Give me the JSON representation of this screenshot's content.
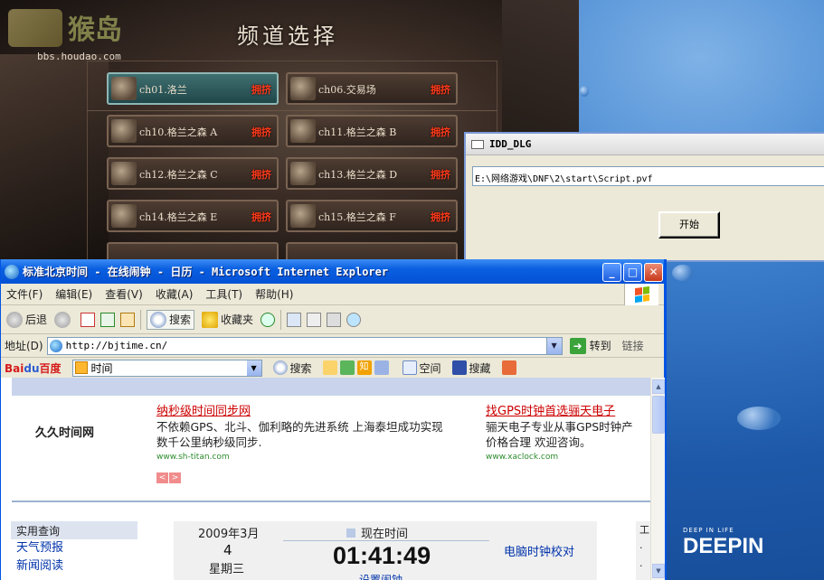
{
  "game": {
    "logo_text": "猴岛",
    "logo_url": "bbs.houdao.com",
    "title": "频道选择",
    "channels": [
      {
        "label": "ch01.洛兰",
        "status": "拥挤",
        "selected": true
      },
      {
        "label": "ch06.交易场",
        "status": "拥挤",
        "selected": false
      },
      {
        "label": "ch10.格兰之森 A",
        "status": "拥挤",
        "selected": false
      },
      {
        "label": "ch11.格兰之森 B",
        "status": "拥挤",
        "selected": false
      },
      {
        "label": "ch12.格兰之森 C",
        "status": "拥挤",
        "selected": false
      },
      {
        "label": "ch13.格兰之森 D",
        "status": "拥挤",
        "selected": false
      },
      {
        "label": "ch14.格兰之森 E",
        "status": "拥挤",
        "selected": false
      },
      {
        "label": "ch15.格兰之森 F",
        "status": "拥挤",
        "selected": false
      }
    ]
  },
  "idd_dialog": {
    "title": "IDD_DLG",
    "path_value": "E:\\网络游戏\\DNF\\2\\start\\Script.pvf",
    "start_button": "开始"
  },
  "ie": {
    "title": "标准北京时间 - 在线闹钟 - 日历 - Microsoft Internet Explorer",
    "caption_buttons": {
      "minimize": "_",
      "maximize": "□",
      "close": "✕"
    },
    "menu": [
      "文件(F)",
      "编辑(E)",
      "查看(V)",
      "收藏(A)",
      "工具(T)",
      "帮助(H)"
    ],
    "toolbar": {
      "back": "后退",
      "search": "搜索",
      "favorites": "收藏夹"
    },
    "address": {
      "label": "地址(D)",
      "url": "http://bjtime.cn/",
      "go": "转到",
      "links": "链接"
    },
    "baidu_bar": {
      "logo_red": "Bai",
      "logo_blue": "du",
      "logo_suffix": "百度",
      "query": "时间",
      "items": [
        "搜索",
        "空间",
        "搜藏"
      ],
      "extra_icon_char": "知"
    },
    "page": {
      "site_name": "久久时间网",
      "ad1": {
        "title": "纳秒级时间同步网",
        "line1": "不依赖GPS、北斗、伽利略的先进系统 上海泰坦成功实现",
        "line2": "数千公里纳秒级同步.",
        "url": "www.sh-titan.com"
      },
      "ad2": {
        "title": "找GPS时钟首选骊天电子",
        "line1": "骊天电子专业从事GPS时钟产",
        "line2": "价格合理 欢迎咨询。",
        "url": "www.xaclock.com"
      },
      "arrows": {
        "left": "<",
        "right": ">"
      },
      "util_head": "实用查询",
      "util_links": [
        "天气预报",
        "新闻阅读"
      ],
      "date_year": "2009年3月",
      "date_day": "4",
      "date_week": "星期三",
      "now_label": "现在时间",
      "clock_time": "01:41:49",
      "alarm_link": "设置闹钟",
      "pc_sync": "电脑时钟校对",
      "right_col": "工"
    }
  },
  "desktop": {
    "brand_small": "DEEP IN LIFE",
    "brand_big": "DEEPIN"
  }
}
